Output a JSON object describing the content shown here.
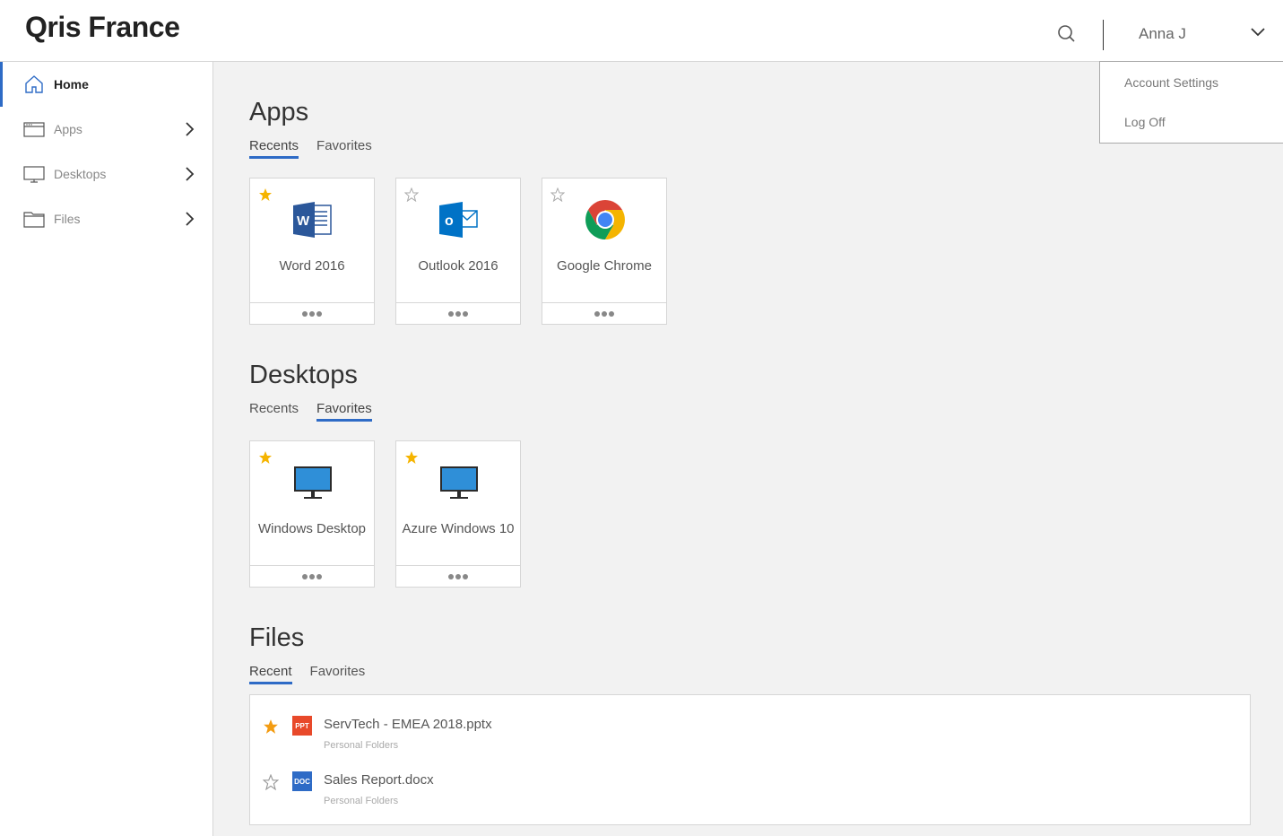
{
  "header": {
    "brand": "Qris France",
    "user_name": "Anna J"
  },
  "user_menu": {
    "items": [
      "Account Settings",
      "Log Off"
    ]
  },
  "sidebar": {
    "items": [
      {
        "label": "Home",
        "icon": "home-icon",
        "active": true
      },
      {
        "label": "Apps",
        "icon": "apps-window-icon"
      },
      {
        "label": "Desktops",
        "icon": "monitor-icon"
      },
      {
        "label": "Files",
        "icon": "folder-icon"
      }
    ]
  },
  "apps": {
    "title": "Apps",
    "tabs": [
      {
        "label": "Recents",
        "active": true
      },
      {
        "label": "Favorites"
      }
    ],
    "tiles": [
      {
        "label": "Word 2016",
        "icon": "word-icon",
        "favorite": true
      },
      {
        "label": "Outlook 2016",
        "icon": "outlook-icon",
        "favorite": false
      },
      {
        "label": "Google Chrome",
        "icon": "chrome-icon",
        "favorite": false
      }
    ]
  },
  "desktops": {
    "title": "Desktops",
    "tabs": [
      {
        "label": "Recents"
      },
      {
        "label": "Favorites",
        "active": true
      }
    ],
    "tiles": [
      {
        "label": "Windows Desktop",
        "icon": "desktop-monitor-icon",
        "favorite": true
      },
      {
        "label": "Azure Windows 10",
        "icon": "desktop-monitor-icon",
        "favorite": true
      }
    ]
  },
  "files": {
    "title": "Files",
    "tabs": [
      {
        "label": "Recent",
        "active": true
      },
      {
        "label": "Favorites"
      }
    ],
    "rows": [
      {
        "name": "ServTech - EMEA 2018.pptx",
        "location": "Personal Folders",
        "type_badge": "PPT",
        "badge_color": "#e8492a",
        "favorite": true
      },
      {
        "name": "Sales Report.docx",
        "location": "Personal Folders",
        "type_badge": "DOC",
        "badge_color": "#2e6bc6",
        "favorite": false
      }
    ]
  },
  "colors": {
    "accent": "#2e6bc6",
    "star": "#f5b400"
  }
}
